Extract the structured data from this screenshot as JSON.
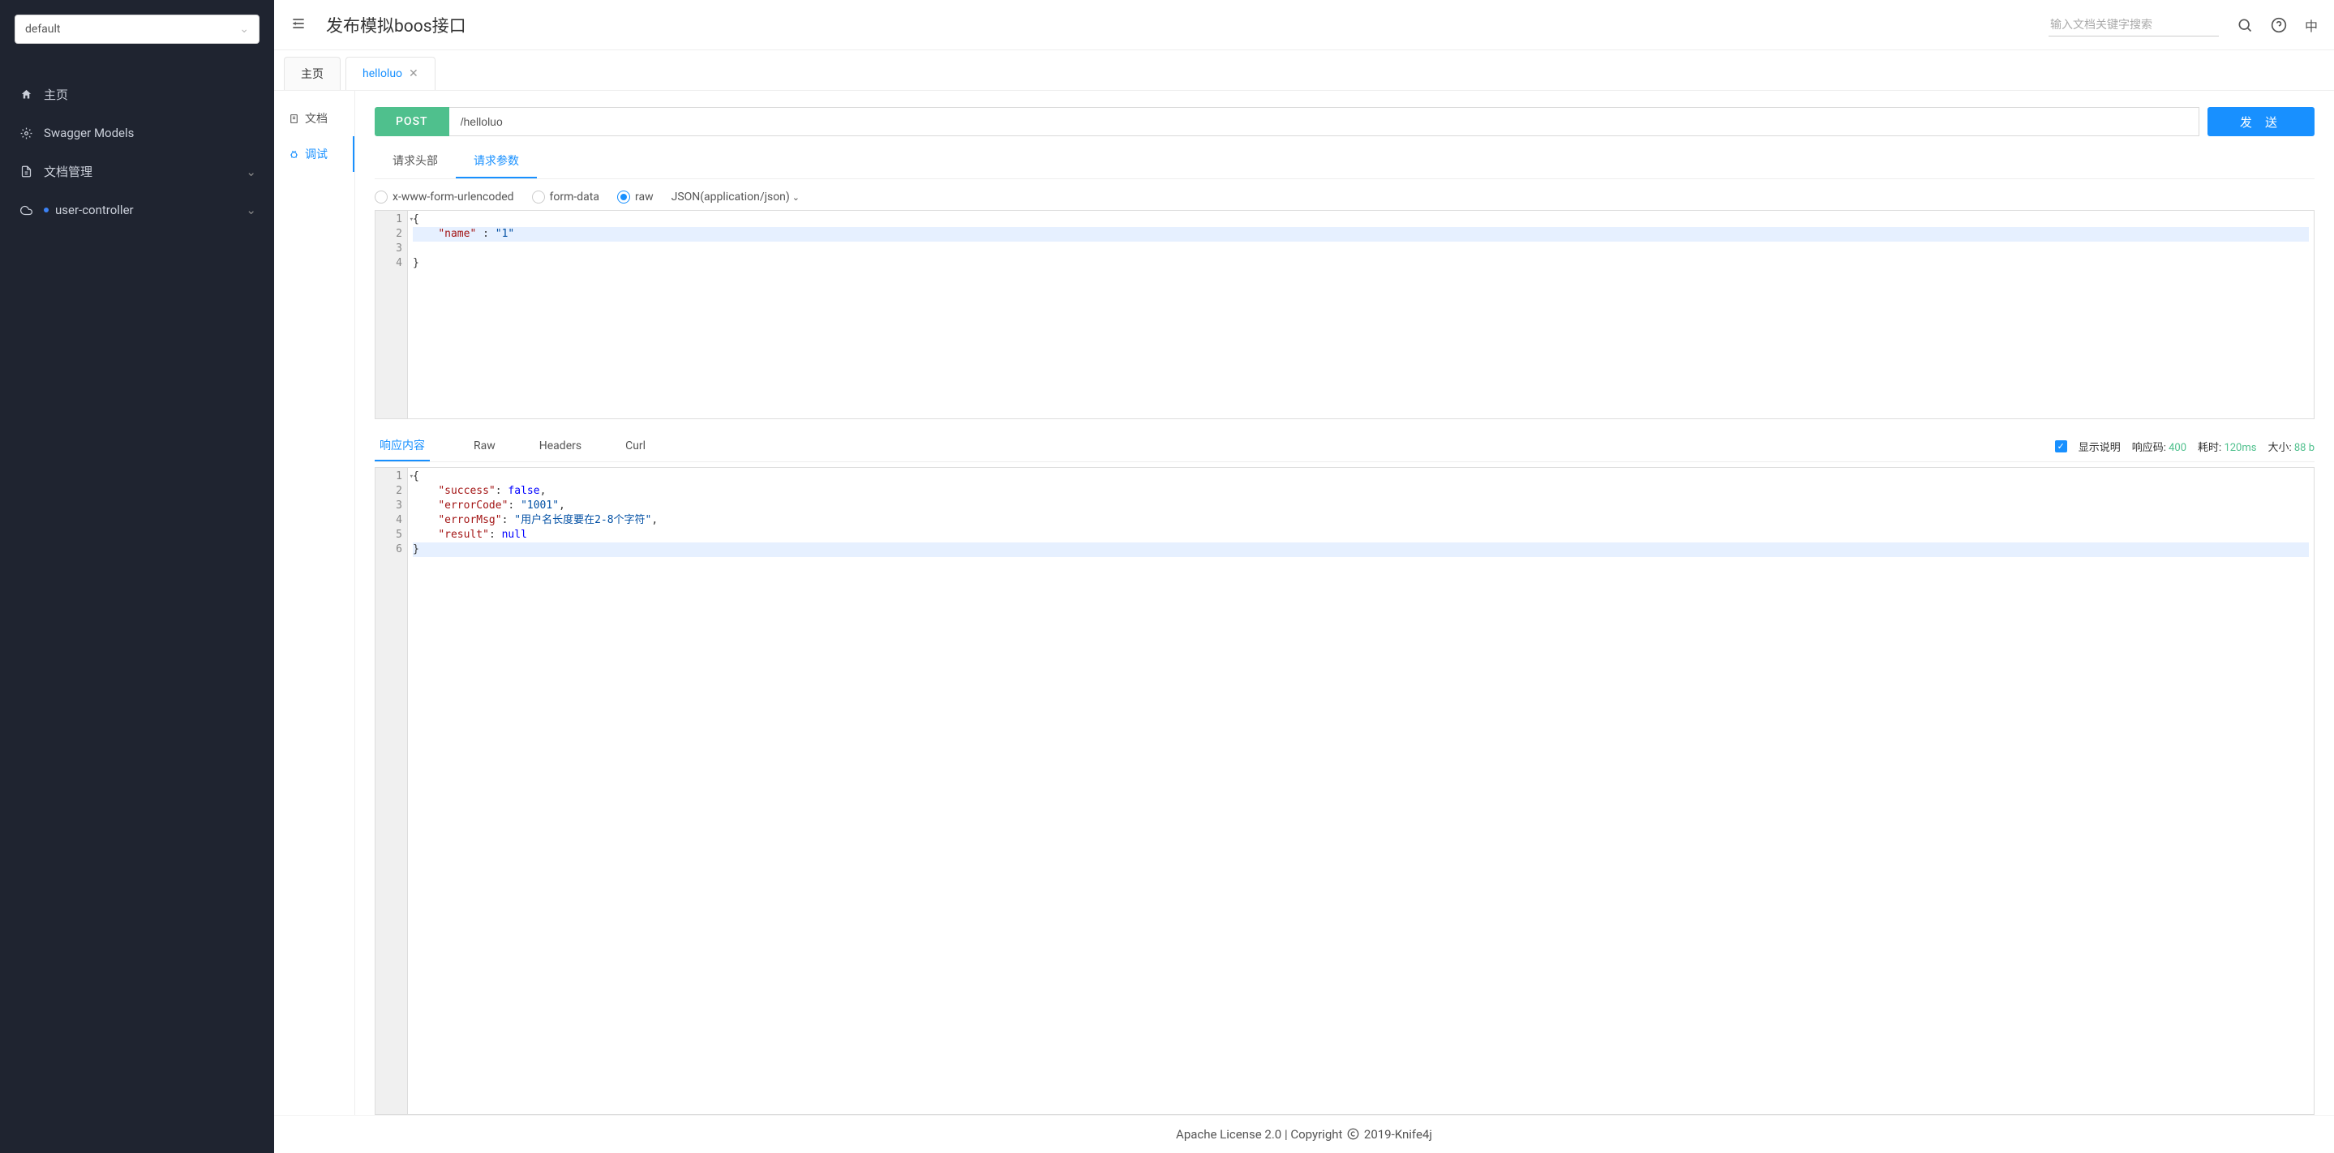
{
  "sidebar": {
    "select_value": "default",
    "items": [
      {
        "label": "主页"
      },
      {
        "label": "Swagger Models"
      },
      {
        "label": "文档管理"
      },
      {
        "label": "user-controller"
      }
    ]
  },
  "header": {
    "title": "发布模拟boos接口",
    "search_placeholder": "输入文档关键字搜索",
    "lang": "中"
  },
  "tabs": [
    {
      "label": "主页",
      "active": false,
      "closable": false
    },
    {
      "label": "helloluo",
      "active": true,
      "closable": true
    }
  ],
  "side_tabs": {
    "doc": "文档",
    "debug": "调试"
  },
  "request": {
    "method": "POST",
    "url": "/helloluo",
    "send_label": "发 送",
    "sub_tabs": {
      "headers": "请求头部",
      "params": "请求参数"
    },
    "body_types": {
      "form": "x-www-form-urlencoded",
      "formdata": "form-data",
      "raw": "raw"
    },
    "content_type": "JSON(application/json)",
    "body_lines": [
      {
        "n": "1",
        "fold": true,
        "text": "{"
      },
      {
        "n": "2",
        "hl": true,
        "segments": [
          [
            "    ",
            ""
          ],
          [
            "\"name\"",
            "k"
          ],
          [
            " : ",
            ""
          ],
          [
            "\"1\"",
            "s"
          ]
        ]
      },
      {
        "n": "3",
        "text": ""
      },
      {
        "n": "4",
        "text": "}"
      }
    ]
  },
  "response": {
    "tabs": {
      "content": "响应内容",
      "raw": "Raw",
      "headers": "Headers",
      "curl": "Curl"
    },
    "show_desc_label": "显示说明",
    "code_label": "响应码:",
    "code_value": "400",
    "time_label": "耗时:",
    "time_value": "120ms",
    "size_label": "大小:",
    "size_value": "88 b",
    "body_lines": [
      {
        "n": "1",
        "fold": true,
        "segments": [
          [
            "{",
            ""
          ]
        ]
      },
      {
        "n": "2",
        "segments": [
          [
            "    ",
            ""
          ],
          [
            "\"success\"",
            "k"
          ],
          [
            ": ",
            ""
          ],
          [
            "false",
            "b"
          ],
          [
            ",",
            ""
          ]
        ]
      },
      {
        "n": "3",
        "segments": [
          [
            "    ",
            ""
          ],
          [
            "\"errorCode\"",
            "k"
          ],
          [
            ": ",
            ""
          ],
          [
            "\"1001\"",
            "s"
          ],
          [
            ",",
            ""
          ]
        ]
      },
      {
        "n": "4",
        "segments": [
          [
            "    ",
            ""
          ],
          [
            "\"errorMsg\"",
            "k"
          ],
          [
            ": ",
            ""
          ],
          [
            "\"用户名长度要在2-8个字符\"",
            "s"
          ],
          [
            ",",
            ""
          ]
        ]
      },
      {
        "n": "5",
        "segments": [
          [
            "    ",
            ""
          ],
          [
            "\"result\"",
            "k"
          ],
          [
            ": ",
            ""
          ],
          [
            "null",
            "null"
          ]
        ]
      },
      {
        "n": "6",
        "hl": true,
        "segments": [
          [
            "}",
            ""
          ]
        ]
      }
    ]
  },
  "footer": {
    "license": "Apache License 2.0",
    "sep": " | ",
    "copyright": "Copyright",
    "rest": " 2019-Knife4j"
  }
}
